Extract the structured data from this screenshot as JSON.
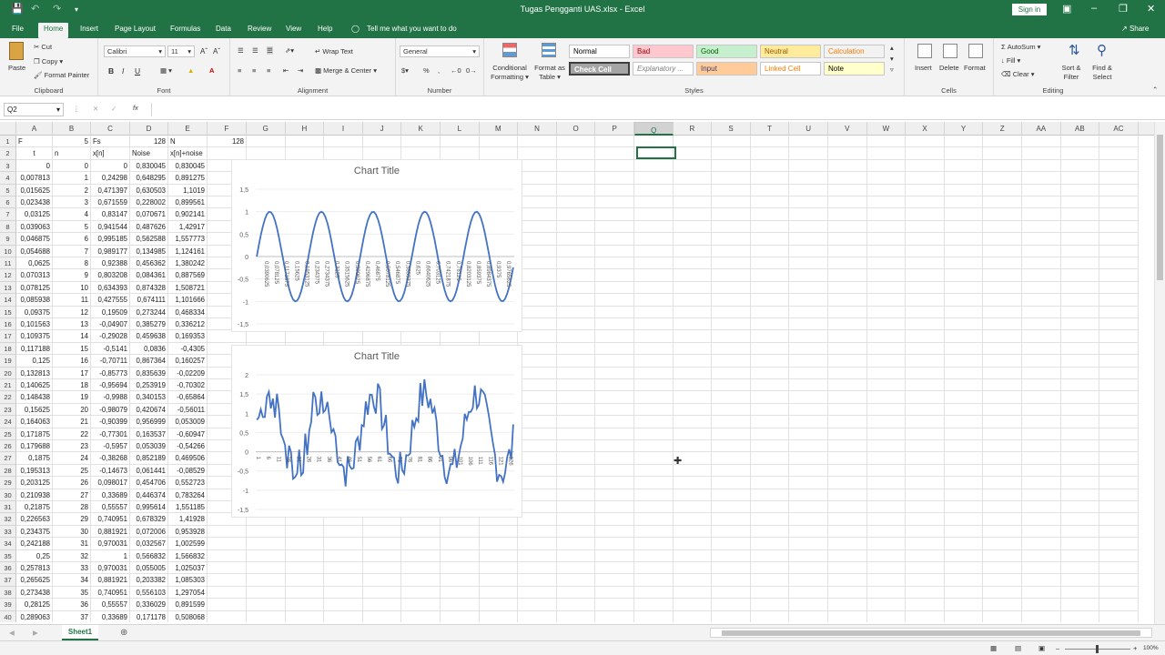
{
  "window": {
    "title": "Tugas Pengganti UAS.xlsx  -  Excel",
    "signin": "Sign in",
    "share": "Share"
  },
  "tabs": [
    "File",
    "Home",
    "Insert",
    "Page Layout",
    "Formulas",
    "Data",
    "Review",
    "View",
    "Help"
  ],
  "tellme": "Tell me what you want to do",
  "ribbon": {
    "clipboard": {
      "label": "Clipboard",
      "paste": "Paste",
      "cut": "Cut",
      "copy": "Copy",
      "format_painter": "Format Painter"
    },
    "font": {
      "label": "Font",
      "name": "Calibri",
      "size": "11"
    },
    "alignment": {
      "label": "Alignment",
      "wrap": "Wrap Text",
      "merge": "Merge & Center"
    },
    "number": {
      "label": "Number",
      "format": "General"
    },
    "styles": {
      "label": "Styles",
      "conditional": "Conditional Formatting",
      "format_table": "Format as Table",
      "cells": [
        {
          "text": "Normal",
          "bg": "#ffffff",
          "fg": "#000000"
        },
        {
          "text": "Bad",
          "bg": "#ffc7ce",
          "fg": "#9c0006"
        },
        {
          "text": "Good",
          "bg": "#c6efce",
          "fg": "#006100"
        },
        {
          "text": "Neutral",
          "bg": "#ffeb9c",
          "fg": "#9c5700"
        },
        {
          "text": "Calculation",
          "bg": "#f2f2f2",
          "fg": "#fa7d00"
        },
        {
          "text": "Check Cell",
          "bg": "#a5a5a5",
          "fg": "#ffffff"
        },
        {
          "text": "Explanatory ...",
          "bg": "#ffffff",
          "fg": "#7f7f7f"
        },
        {
          "text": "Input",
          "bg": "#ffcc99",
          "fg": "#3f3f76"
        },
        {
          "text": "Linked Cell",
          "bg": "#ffffff",
          "fg": "#fa7d00"
        },
        {
          "text": "Note",
          "bg": "#ffffcc",
          "fg": "#000000"
        }
      ]
    },
    "cells": {
      "label": "Cells",
      "insert": "Insert",
      "delete": "Delete",
      "format": "Format"
    },
    "editing": {
      "label": "Editing",
      "autosum": "AutoSum",
      "fill": "Fill",
      "clear": "Clear",
      "sort": "Sort & Filter",
      "find": "Find & Select"
    }
  },
  "namebox": "Q2",
  "columns": [
    "A",
    "B",
    "C",
    "D",
    "E",
    "F",
    "G",
    "H",
    "I",
    "J",
    "K",
    "L",
    "M",
    "N",
    "O",
    "P",
    "Q",
    "R",
    "S",
    "T",
    "U",
    "V",
    "W",
    "X",
    "Y",
    "Z",
    "AA",
    "AB",
    "AC"
  ],
  "selected_col": "Q",
  "rows": [
    [
      "F",
      "5",
      "Fs",
      "128",
      "N",
      "128"
    ],
    [
      "t",
      "n",
      "x[n]",
      "Noise",
      "x[n]+noise",
      ""
    ],
    [
      "0",
      "0",
      "0",
      "0,830045",
      "0,830045",
      ""
    ],
    [
      "0,007813",
      "1",
      "0,24298",
      "0,648295",
      "0,891275",
      ""
    ],
    [
      "0,015625",
      "2",
      "0,471397",
      "0,630503",
      "1,1019",
      ""
    ],
    [
      "0,023438",
      "3",
      "0,671559",
      "0,228002",
      "0,899561",
      ""
    ],
    [
      "0,03125",
      "4",
      "0,83147",
      "0,070671",
      "0,902141",
      ""
    ],
    [
      "0,039063",
      "5",
      "0,941544",
      "0,487626",
      "1,42917",
      ""
    ],
    [
      "0,046875",
      "6",
      "0,995185",
      "0,562588",
      "1,557773",
      ""
    ],
    [
      "0,054688",
      "7",
      "0,989177",
      "0,134985",
      "1,124161",
      ""
    ],
    [
      "0,0625",
      "8",
      "0,92388",
      "0,456362",
      "1,380242",
      ""
    ],
    [
      "0,070313",
      "9",
      "0,803208",
      "0,084361",
      "0,887569",
      ""
    ],
    [
      "0,078125",
      "10",
      "0,634393",
      "0,874328",
      "1,508721",
      ""
    ],
    [
      "0,085938",
      "11",
      "0,427555",
      "0,674111",
      "1,101666",
      ""
    ],
    [
      "0,09375",
      "12",
      "0,19509",
      "0,273244",
      "0,468334",
      ""
    ],
    [
      "0,101563",
      "13",
      "-0,04907",
      "0,385279",
      "0,336212",
      ""
    ],
    [
      "0,109375",
      "14",
      "-0,29028",
      "0,459638",
      "0,169353",
      ""
    ],
    [
      "0,117188",
      "15",
      "-0,5141",
      "0,0836",
      "-0,4305",
      ""
    ],
    [
      "0,125",
      "16",
      "-0,70711",
      "0,867364",
      "0,160257",
      ""
    ],
    [
      "0,132813",
      "17",
      "-0,85773",
      "0,835639",
      "-0,02209",
      ""
    ],
    [
      "0,140625",
      "18",
      "-0,95694",
      "0,253919",
      "-0,70302",
      ""
    ],
    [
      "0,148438",
      "19",
      "-0,9988",
      "0,340153",
      "-0,65864",
      ""
    ],
    [
      "0,15625",
      "20",
      "-0,98079",
      "0,420674",
      "-0,56011",
      ""
    ],
    [
      "0,164063",
      "21",
      "-0,90399",
      "0,956999",
      "0,053009",
      ""
    ],
    [
      "0,171875",
      "22",
      "-0,77301",
      "0,163537",
      "-0,60947",
      ""
    ],
    [
      "0,179688",
      "23",
      "-0,5957",
      "0,053039",
      "-0,54266",
      ""
    ],
    [
      "0,1875",
      "24",
      "-0,38268",
      "0,852189",
      "0,469506",
      ""
    ],
    [
      "0,195313",
      "25",
      "-0,14673",
      "0,061441",
      "-0,08529",
      ""
    ],
    [
      "0,203125",
      "26",
      "0,098017",
      "0,454706",
      "0,552723",
      ""
    ],
    [
      "0,210938",
      "27",
      "0,33689",
      "0,446374",
      "0,783264",
      ""
    ],
    [
      "0,21875",
      "28",
      "0,55557",
      "0,995614",
      "1,551185",
      ""
    ],
    [
      "0,226563",
      "29",
      "0,740951",
      "0,678329",
      "1,41928",
      ""
    ],
    [
      "0,234375",
      "30",
      "0,881921",
      "0,072006",
      "0,953928",
      ""
    ],
    [
      "0,242188",
      "31",
      "0,970031",
      "0,032567",
      "1,002599",
      ""
    ],
    [
      "0,25",
      "32",
      "1",
      "0,566832",
      "1,566832",
      ""
    ],
    [
      "0,257813",
      "33",
      "0,970031",
      "0,055005",
      "1,025037",
      ""
    ],
    [
      "0,265625",
      "34",
      "0,881921",
      "0,203382",
      "1,085303",
      ""
    ],
    [
      "0,273438",
      "35",
      "0,740951",
      "0,556103",
      "1,297054",
      ""
    ],
    [
      "0,28125",
      "36",
      "0,55557",
      "0,336029",
      "0,891599",
      ""
    ],
    [
      "0,289063",
      "37",
      "0,33689",
      "0,171178",
      "0,508068",
      ""
    ]
  ],
  "sheet": "Sheet1",
  "zoom": "100%",
  "chart_data": [
    {
      "type": "line",
      "title": "Chart Title",
      "ylim": [
        -1.5,
        1.5
      ],
      "yticks": [
        "1,5",
        "1",
        "0,5",
        "0",
        "-0,5",
        "-1",
        "-1,5"
      ],
      "xticks": [
        "0,0390625",
        "0,078125",
        "0,1171875",
        "0,15625",
        "0,1953125",
        "0,234375",
        "0,2734375",
        "0,3125",
        "0,3515625",
        "0,390625",
        "0,4296875",
        "0,46875",
        "0,5078125",
        "0,546875",
        "0,5859375",
        "0,625",
        "0,6640625",
        "0,703125",
        "0,7421875",
        "0,78125",
        "0,8203125",
        "0,859375",
        "0,8984375",
        "0,9375",
        "0,9765625"
      ],
      "series": [
        {
          "expr": "sin(2*pi*5*t)",
          "n": 128,
          "fs": 128
        }
      ]
    },
    {
      "type": "line",
      "title": "Chart Title",
      "ylim": [
        -1.5,
        2
      ],
      "yticks": [
        "2",
        "1,5",
        "1",
        "0,5",
        "0",
        "-0,5",
        "-1",
        "-1,5"
      ],
      "xticks": [
        "1",
        "6",
        "11",
        "16",
        "21",
        "26",
        "31",
        "36",
        "41",
        "46",
        "51",
        "56",
        "61",
        "66",
        "71",
        "76",
        "81",
        "86",
        "91",
        "96",
        "101",
        "106",
        "111",
        "116",
        "121",
        "126"
      ],
      "series": [
        {
          "expr": "sin(2*pi*5*t)+noise",
          "n": 128
        }
      ]
    }
  ]
}
